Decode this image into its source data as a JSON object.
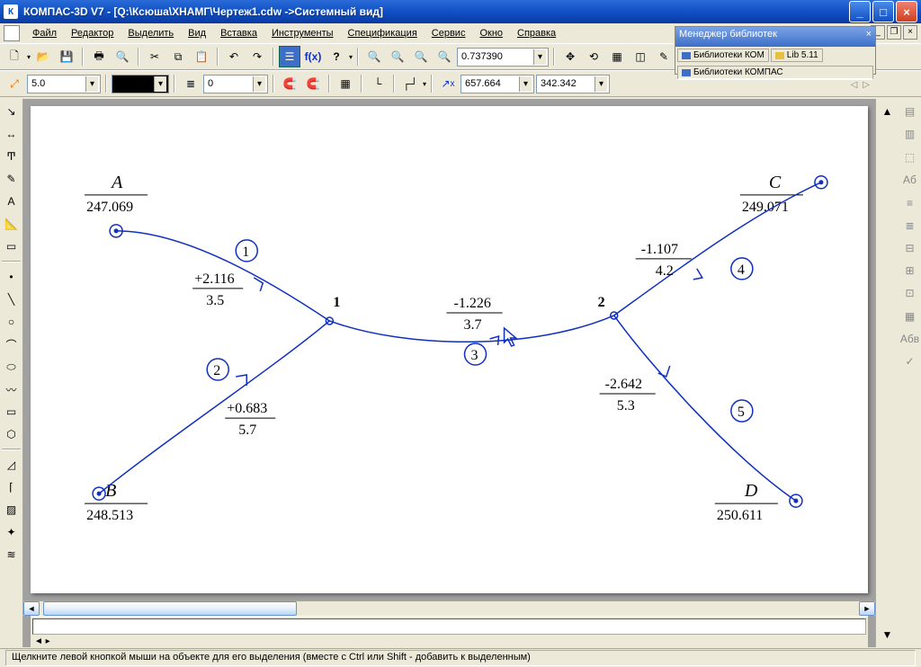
{
  "title": "КОМПАС-3D V7 - [Q:\\Ксюша\\ХНАМГ\\Чертеж1.cdw ->Системный вид]",
  "menu": [
    "Файл",
    "Редактор",
    "Выделить",
    "Вид",
    "Вставка",
    "Инструменты",
    "Спецификация",
    "Сервис",
    "Окно",
    "Справка"
  ],
  "libmgr": {
    "title": "Менеджер библиотек",
    "tab1": "Библиотеки КОМ",
    "tab2": "Lib 5.11",
    "tab_active": "Библиотеки КОМПАС"
  },
  "toolbar1": {
    "zoom": "0.737390"
  },
  "toolbar2": {
    "step": "5.0",
    "layer": "0",
    "cx": "657.664",
    "cy": "342.342"
  },
  "status": "Щелкните левой кнопкой мыши на объекте для его выделения (вместе с Ctrl или Shift - добавить к выделенным)",
  "points": {
    "A": {
      "label": "A",
      "val": "247.069"
    },
    "B": {
      "label": "B",
      "val": "248.513"
    },
    "C": {
      "label": "C",
      "val": "249.071"
    },
    "D": {
      "label": "D",
      "val": "250.611"
    },
    "n1": "1",
    "n2": "2"
  },
  "edges": {
    "1": {
      "n": "1",
      "top": "+2.116",
      "bot": "3.5"
    },
    "2": {
      "n": "2",
      "top": "+0.683",
      "bot": "5.7"
    },
    "3": {
      "n": "3",
      "top": "-1.226",
      "bot": "3.7"
    },
    "4": {
      "n": "4",
      "top": "-1.107",
      "bot": "4.2"
    },
    "5": {
      "n": "5",
      "top": "-2.642",
      "bot": "5.3"
    }
  }
}
